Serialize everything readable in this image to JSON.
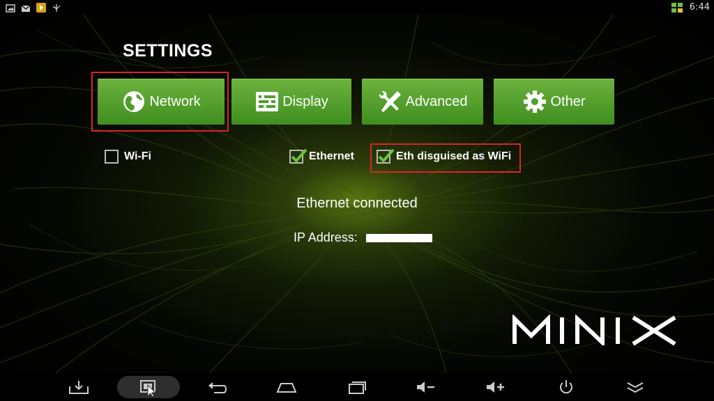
{
  "status_bar": {
    "time": "6:44",
    "icons": [
      "image-icon",
      "mail-icon",
      "app-notification-icon",
      "usb-icon",
      "network-status-icon"
    ]
  },
  "page": {
    "title": "SETTINGS"
  },
  "tabs": [
    {
      "label": "Network",
      "icon": "globe-icon",
      "selected": true
    },
    {
      "label": "Display",
      "icon": "display-settings-icon",
      "selected": false
    },
    {
      "label": "Advanced",
      "icon": "tools-icon",
      "selected": false
    },
    {
      "label": "Other",
      "icon": "gear-icon",
      "selected": false
    }
  ],
  "options": [
    {
      "label": "Wi-Fi",
      "checked": false
    },
    {
      "label": "Ethernet",
      "checked": true
    },
    {
      "label": "Eth disguised as WiFi",
      "checked": true
    }
  ],
  "status": {
    "message": "Ethernet connected",
    "ip_label": "IP Address:",
    "ip_value": ""
  },
  "brand": {
    "logo_text": "MINIX"
  },
  "nav_bar": {
    "buttons": [
      "download-icon",
      "screenshot-icon",
      "back-icon",
      "home-icon",
      "recent-apps-icon",
      "volume-down-icon",
      "volume-up-icon",
      "power-icon",
      "hide-bar-icon"
    ]
  },
  "colors": {
    "tab_green": "#4f9f2a",
    "highlight_red": "#d7262a",
    "check_green": "#6cc040"
  }
}
